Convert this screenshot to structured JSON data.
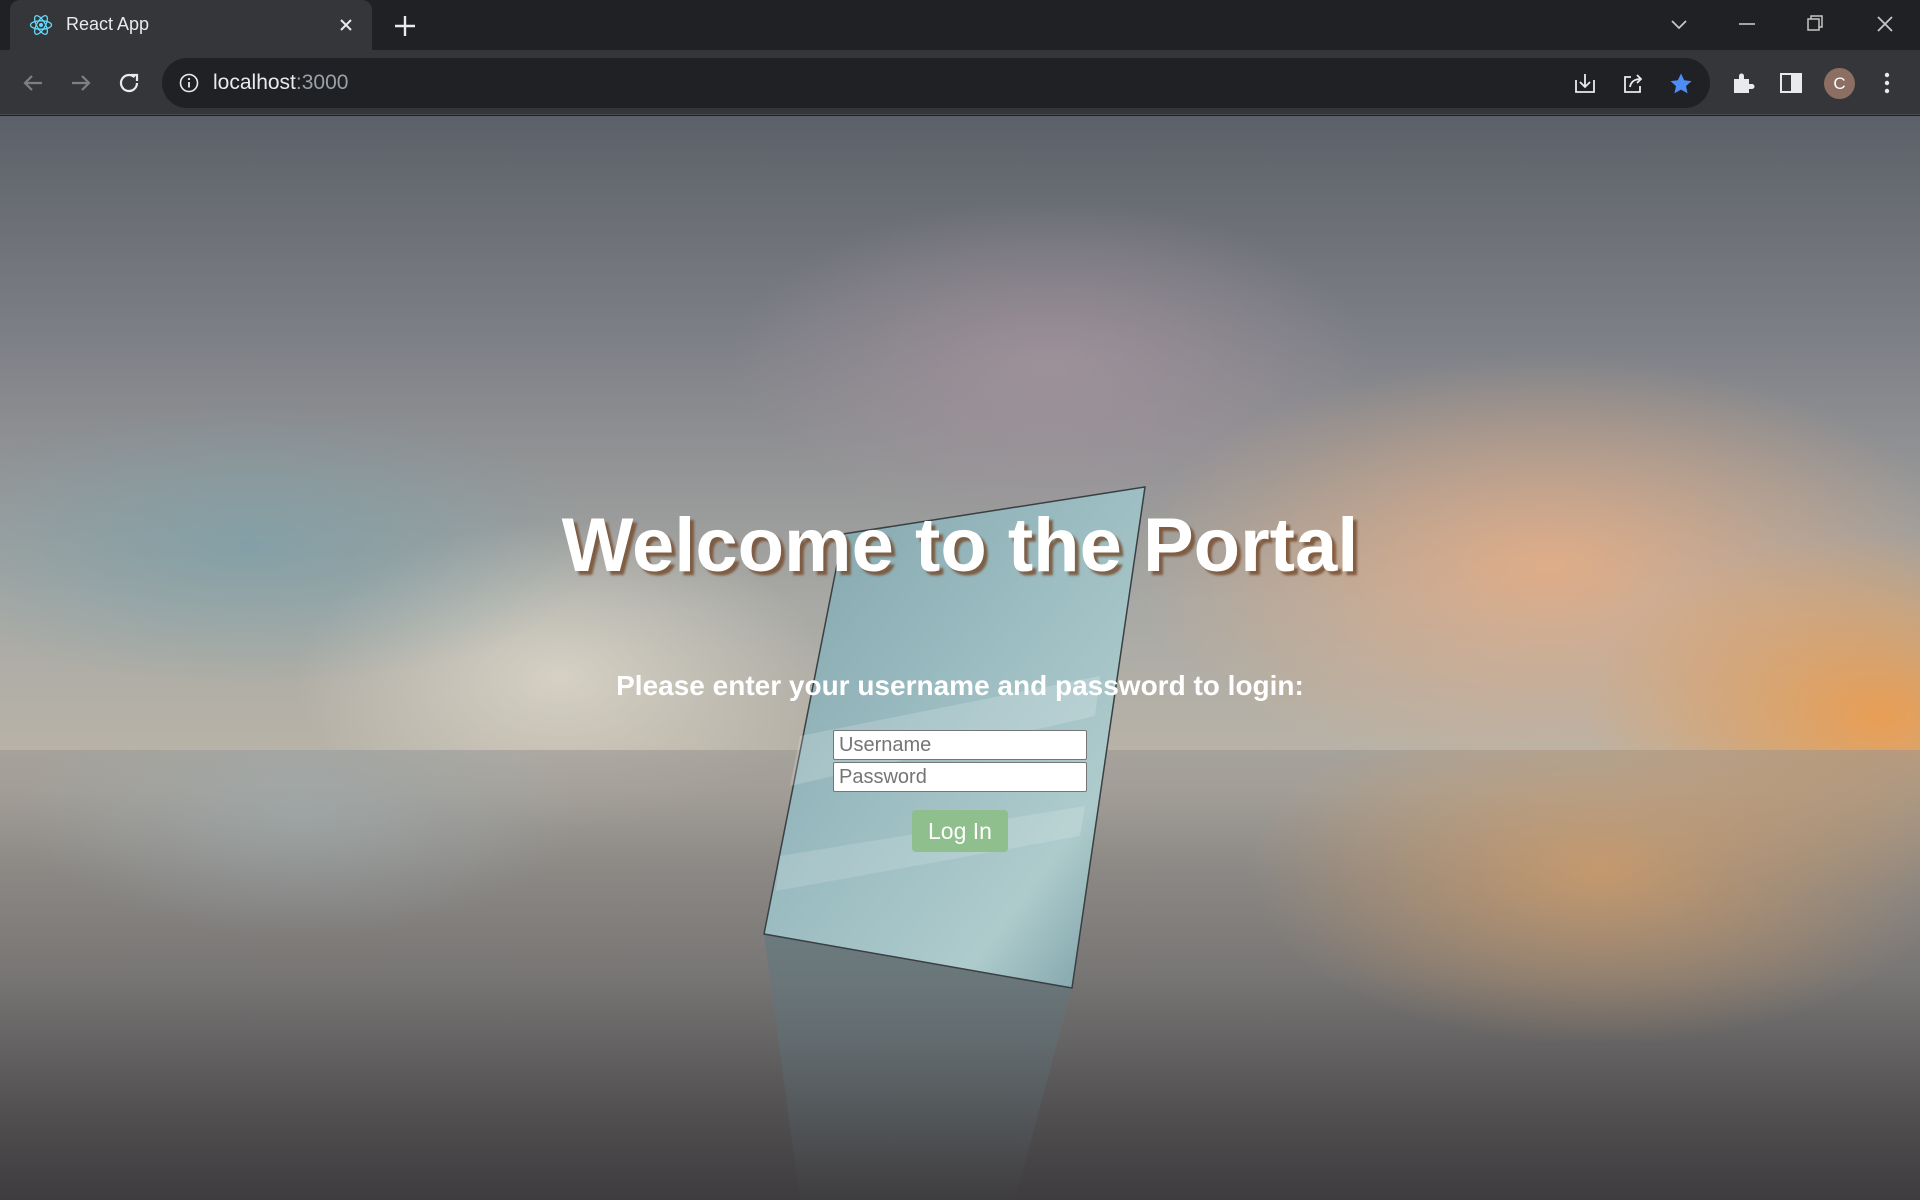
{
  "browser": {
    "tab_title": "React App",
    "url_host": "localhost",
    "url_port": ":3000",
    "avatar_letter": "C"
  },
  "page": {
    "welcome": "Welcome to the Portal",
    "prompt": "Please enter your username and password to login:",
    "username_placeholder": "Username",
    "password_placeholder": "Password",
    "login_label": "Log In"
  },
  "colors": {
    "login_button": "#8fbf8c",
    "bookmark_star": "#4c8df6"
  }
}
